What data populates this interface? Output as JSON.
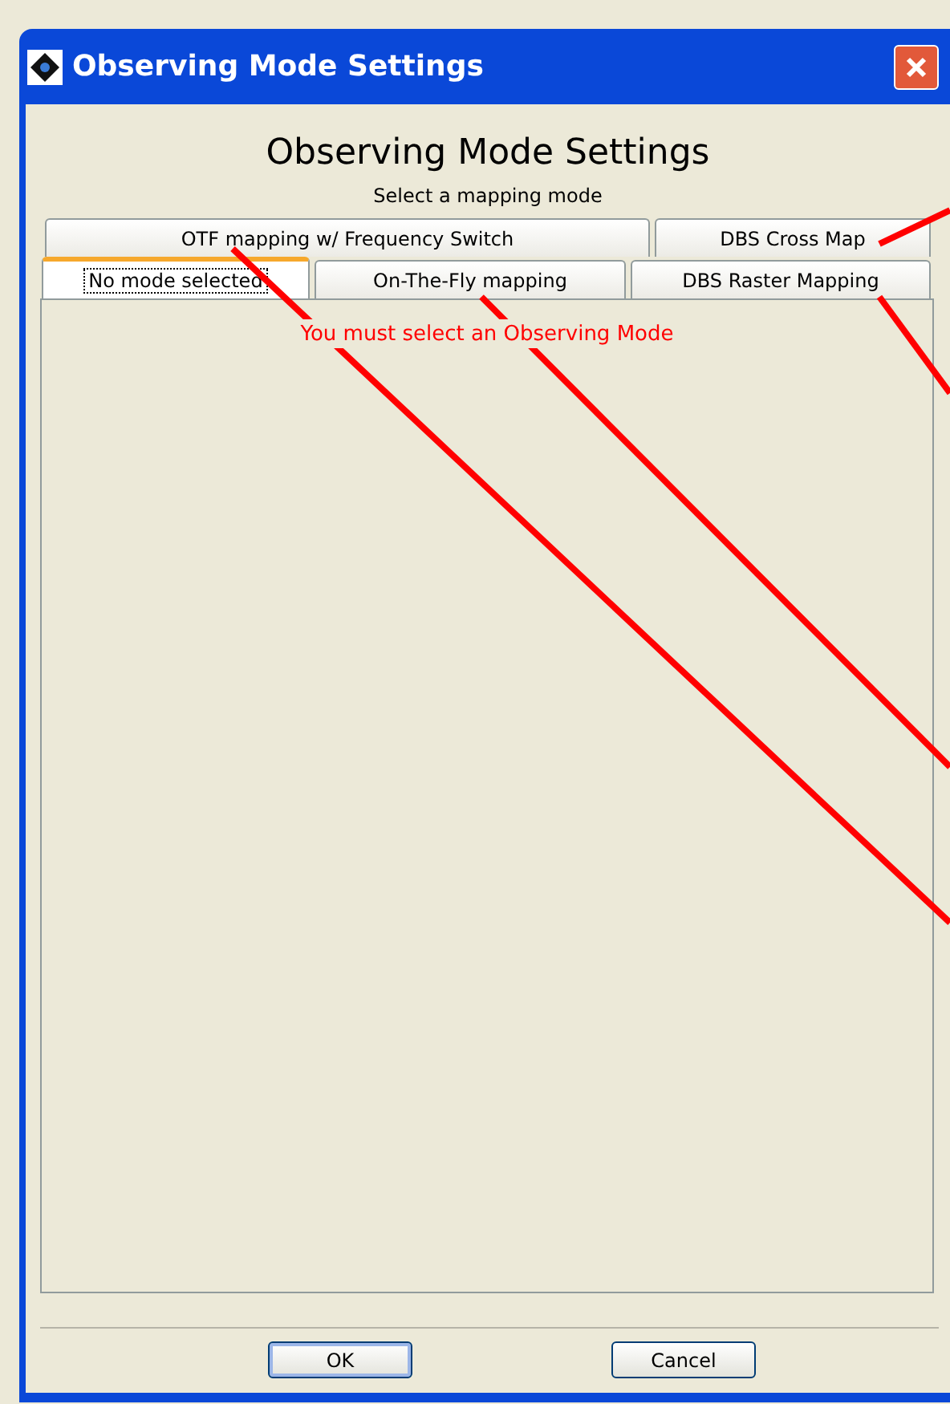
{
  "window": {
    "title": "Observing Mode Settings"
  },
  "header": {
    "title": "Observing Mode Settings",
    "subtitle": "Select a mapping mode"
  },
  "tab_rows": [
    [
      {
        "label": "OTF mapping w/ Frequency Switch",
        "selected": false
      },
      {
        "label": "DBS Cross Map",
        "selected": false
      }
    ],
    [
      {
        "label": "No mode selected",
        "selected": true
      },
      {
        "label": "On-The-Fly mapping",
        "selected": false
      },
      {
        "label": "DBS Raster Mapping",
        "selected": false
      }
    ]
  ],
  "message": "You must select an Observing Mode",
  "buttons": [
    {
      "label": "OK",
      "default": true
    },
    {
      "label": "Cancel",
      "default": false
    }
  ],
  "annotations": [
    {
      "kind": "leader"
    },
    {
      "kind": "leader"
    },
    {
      "kind": "leader"
    },
    {
      "kind": "leader"
    }
  ]
}
